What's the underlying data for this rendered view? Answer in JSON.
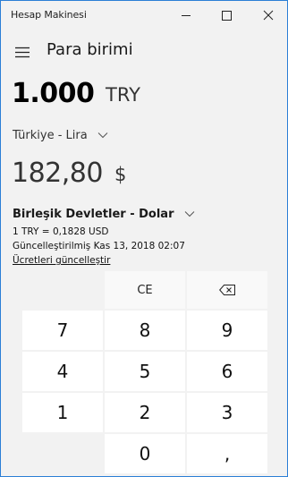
{
  "window": {
    "title": "Hesap Makinesi"
  },
  "header": {
    "mode_title": "Para birimi"
  },
  "converter": {
    "from": {
      "value": "1.000",
      "unit": "TRY",
      "currency": "Türkiye - Lira"
    },
    "to": {
      "value": "182,80",
      "unit": "$",
      "currency": "Birleşik Devletler - Dolar"
    },
    "rate_text": "1 TRY = 0,1828 USD",
    "updated_text": "Güncelleştirilmiş Kas 13, 2018 02:07",
    "update_link": "Ücretleri güncelleştir"
  },
  "keypad": {
    "ce": "CE",
    "backspace_icon": "backspace-icon",
    "k7": "7",
    "k8": "8",
    "k9": "9",
    "k4": "4",
    "k5": "5",
    "k6": "6",
    "k1": "1",
    "k2": "2",
    "k3": "3",
    "k0": "0",
    "comma": ","
  }
}
